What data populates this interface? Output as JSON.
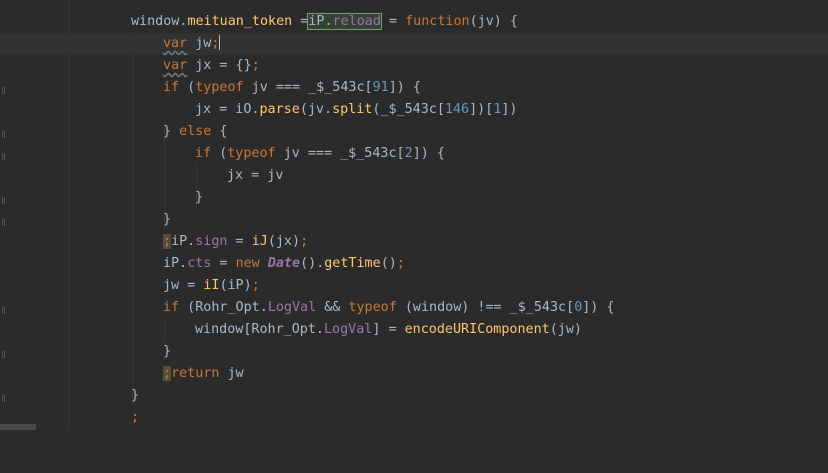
{
  "editor": {
    "colors": {
      "background": "#2b2b2b",
      "current_line": "#323232",
      "keyword": "#cc7832",
      "function": "#ffc66d",
      "property": "#9876aa",
      "number": "#6897bb",
      "text": "#a9b7c6",
      "match_highlight": "#6ba36b"
    },
    "lines": {
      "l1": {
        "a": "window.",
        "b": "meituan_token",
        "c": " =",
        "d": "iP.",
        "e": "reload",
        "f": " = ",
        "g": "function",
        "h": "(jv) {"
      },
      "l2": {
        "a": "var",
        "b": " jw",
        "c": ";"
      },
      "l3": {
        "a": "var",
        "b": " jx = {}",
        "c": ";"
      },
      "l4": {
        "a": "if",
        "b": " (",
        "c": "typeof",
        "d": " jv === _$_543c[",
        "e": "91",
        "f": "]) {"
      },
      "l5": {
        "a": "jx = iO.",
        "b": "parse",
        "c": "(jv.",
        "d": "split",
        "e": "(_$_543c[",
        "f": "146",
        "g": "])[",
        "h": "1",
        "i": "])"
      },
      "l6": {
        "a": "} ",
        "b": "else",
        "c": " {"
      },
      "l7": {
        "a": "if",
        "b": " (",
        "c": "typeof",
        "d": " jv === _$_543c[",
        "e": "2",
        "f": "]) {"
      },
      "l8": {
        "a": "jx = jv"
      },
      "l9": {
        "a": "}"
      },
      "l10": {
        "a": "}"
      },
      "l11": {
        "a": ";",
        "b": "iP.",
        "c": "sign",
        "d": " = ",
        "e": "iJ",
        "f": "(jx)",
        "g": ";"
      },
      "l12": {
        "a": "iP.",
        "b": "cts",
        "c": " = ",
        "d": "new ",
        "e": "Date",
        "f": "().",
        "g": "getTime",
        "h": "()",
        "i": ";"
      },
      "l13": {
        "a": "jw = ",
        "b": "iI",
        "c": "(iP)",
        "d": ";"
      },
      "l14": {
        "a": "if",
        "b": " (Rohr_Opt.",
        "c": "LogVal",
        "d": " && ",
        "e": "typeof",
        "f": " (window) !== _$_543c[",
        "g": "0",
        "h": "]) {"
      },
      "l15": {
        "a": "window[Rohr_Opt.",
        "b": "LogVal",
        "c": "] = ",
        "d": "encodeURIComponent",
        "e": "(jw)"
      },
      "l16": {
        "a": "}"
      },
      "l17": {
        "a": ";",
        "b": "return",
        "c": " jw"
      },
      "l18": {
        "a": "}"
      },
      "l19": {
        "a": ";"
      }
    }
  }
}
